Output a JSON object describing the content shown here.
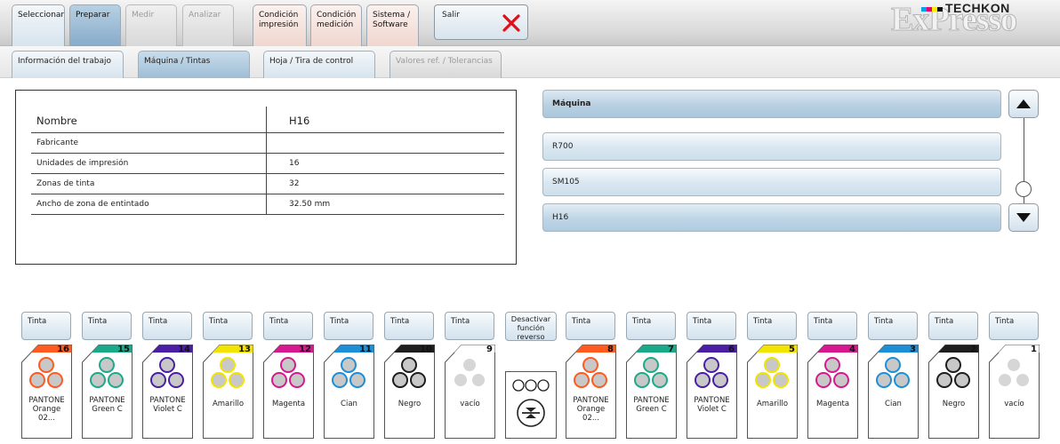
{
  "top_tabs": {
    "seleccionar": "Seleccionar",
    "preparar": "Preparar",
    "medir": "Medir",
    "analizar": "Analizar",
    "condicion_impresion": [
      "Condición",
      "impresión"
    ],
    "condicion_medicion": [
      "Condición",
      "medición"
    ],
    "sistema": [
      "Sistema /",
      "Software"
    ],
    "salir": "Salir"
  },
  "logo": {
    "brand": "TECHKON",
    "product": "ExPresso"
  },
  "sub_tabs": {
    "informacion": "Información del trabajo",
    "maquina": "Máquina / Tintas",
    "hoja": "Hoja / Tira de control",
    "valores": "Valores ref. / Tolerancias"
  },
  "info": {
    "header": {
      "label": "Nombre",
      "value": "H16"
    },
    "rows": [
      {
        "label": "Fabricante",
        "value": ""
      },
      {
        "label": "Unidades de impresión",
        "value": "16"
      },
      {
        "label": "Zonas de tinta",
        "value": "32"
      },
      {
        "label": "Ancho de zona de entintado",
        "value": "32.50 mm"
      }
    ]
  },
  "machines": {
    "header": "Máquina",
    "items": [
      "R700",
      "SM105",
      "H16"
    ],
    "selected": "H16"
  },
  "units": {
    "button_label": "Tinta",
    "reverse_label": [
      "Desactivar",
      "función",
      "reverso"
    ],
    "items": [
      {
        "num": "16",
        "name": [
          "PANTONE",
          "Orange 02..."
        ],
        "color": "#ff5a1f"
      },
      {
        "num": "15",
        "name": [
          "PANTONE",
          "Green C"
        ],
        "color": "#1aaa8a"
      },
      {
        "num": "14",
        "name": [
          "PANTONE",
          "Violet C"
        ],
        "color": "#4a1fa5"
      },
      {
        "num": "13",
        "name": [
          "Amarillo"
        ],
        "color": "#f2e400"
      },
      {
        "num": "12",
        "name": [
          "Magenta"
        ],
        "color": "#d6198f"
      },
      {
        "num": "11",
        "name": [
          "Cian"
        ],
        "color": "#1c8fd6"
      },
      {
        "num": "10",
        "name": [
          "Negro"
        ],
        "color": "#1e1e1e"
      },
      {
        "num": "9",
        "name": [
          "vacío"
        ],
        "color": ""
      },
      {
        "num": "8",
        "name": [
          "PANTONE",
          "Orange 02..."
        ],
        "color": "#ff5a1f"
      },
      {
        "num": "7",
        "name": [
          "PANTONE",
          "Green C"
        ],
        "color": "#1aaa8a"
      },
      {
        "num": "6",
        "name": [
          "PANTONE",
          "Violet C"
        ],
        "color": "#4a1fa5"
      },
      {
        "num": "5",
        "name": [
          "Amarillo"
        ],
        "color": "#f2e400"
      },
      {
        "num": "4",
        "name": [
          "Magenta"
        ],
        "color": "#d6198f"
      },
      {
        "num": "3",
        "name": [
          "Cian"
        ],
        "color": "#1c8fd6"
      },
      {
        "num": "2",
        "name": [
          "Negro"
        ],
        "color": "#1e1e1e"
      },
      {
        "num": "1",
        "name": [
          "vacío"
        ],
        "color": ""
      }
    ]
  }
}
